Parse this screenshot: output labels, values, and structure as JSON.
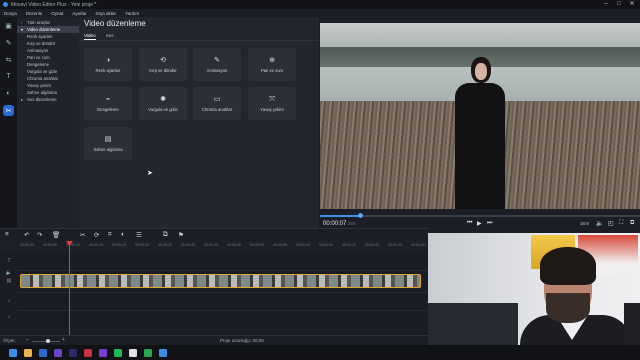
{
  "window": {
    "title": "Movavi Video Editor Plus - Yeni proje *"
  },
  "menu": [
    "Dosya",
    "Düzenle",
    "Oynat",
    "Ayarlar",
    "Dışa aktar",
    "Yardım"
  ],
  "tools": [
    {
      "name": "import-icon",
      "glyph": "▣"
    },
    {
      "name": "filters-icon",
      "glyph": "✎"
    },
    {
      "name": "transitions-icon",
      "glyph": "⇆"
    },
    {
      "name": "titles-icon",
      "glyph": "T"
    },
    {
      "name": "stickers-icon",
      "glyph": "◐"
    },
    {
      "name": "tools-icon",
      "glyph": "✂"
    }
  ],
  "nav": {
    "all_tools": "Tüm araçlar",
    "video_editing": "Video düzenleme",
    "items": [
      "Renk ayarları",
      "Kırp ve döndür",
      "Animasyon",
      "Pan ve zum",
      "Dengeleme",
      "Vurgula ve gizle",
      "Chroma anahtar",
      "Yavaş çekim",
      "Sahne algılama"
    ],
    "audio_editing": "Ses düzenleme"
  },
  "content": {
    "title": "Video düzenleme",
    "tabs": [
      "Video",
      "Ses"
    ],
    "cards": [
      {
        "label": "Renk ayarları",
        "icon": "◑"
      },
      {
        "label": "Kırp ve döndür",
        "icon": "⟲"
      },
      {
        "label": "Animasyon",
        "icon": "✎"
      },
      {
        "label": "Pan ve zum",
        "icon": "⊕"
      },
      {
        "label": "Dengeleme",
        "icon": "⌁"
      },
      {
        "label": "Vurgula ve gizle",
        "icon": "✺"
      },
      {
        "label": "Chroma anahtar",
        "icon": "▭"
      },
      {
        "label": "Yavaş çekim",
        "icon": "⤧"
      },
      {
        "label": "Sahne algılama",
        "icon": "▤"
      }
    ]
  },
  "player": {
    "timecode": "00:00:07",
    "timecode_ms": "203",
    "aspect": "16:9",
    "progress": 0.125
  },
  "timeline": {
    "ruler": [
      "00:00:00",
      "00:00:05",
      "00:00:10",
      "00:00:15",
      "00:00:20",
      "00:00:25",
      "00:00:30",
      "00:00:35",
      "00:00:40",
      "00:00:45",
      "00:00:50",
      "00:00:55",
      "00:01:00",
      "00:01:05",
      "00:01:10",
      "00:01:15",
      "00:01:20",
      "00:01:25"
    ],
    "zoom_label": "Ölçek:",
    "project_length": "Proje uzunluğu: 00:59"
  },
  "colors": {
    "accent": "#2a6bd4",
    "clip_border": "#e0a832",
    "playhead": "#e23b3b"
  }
}
